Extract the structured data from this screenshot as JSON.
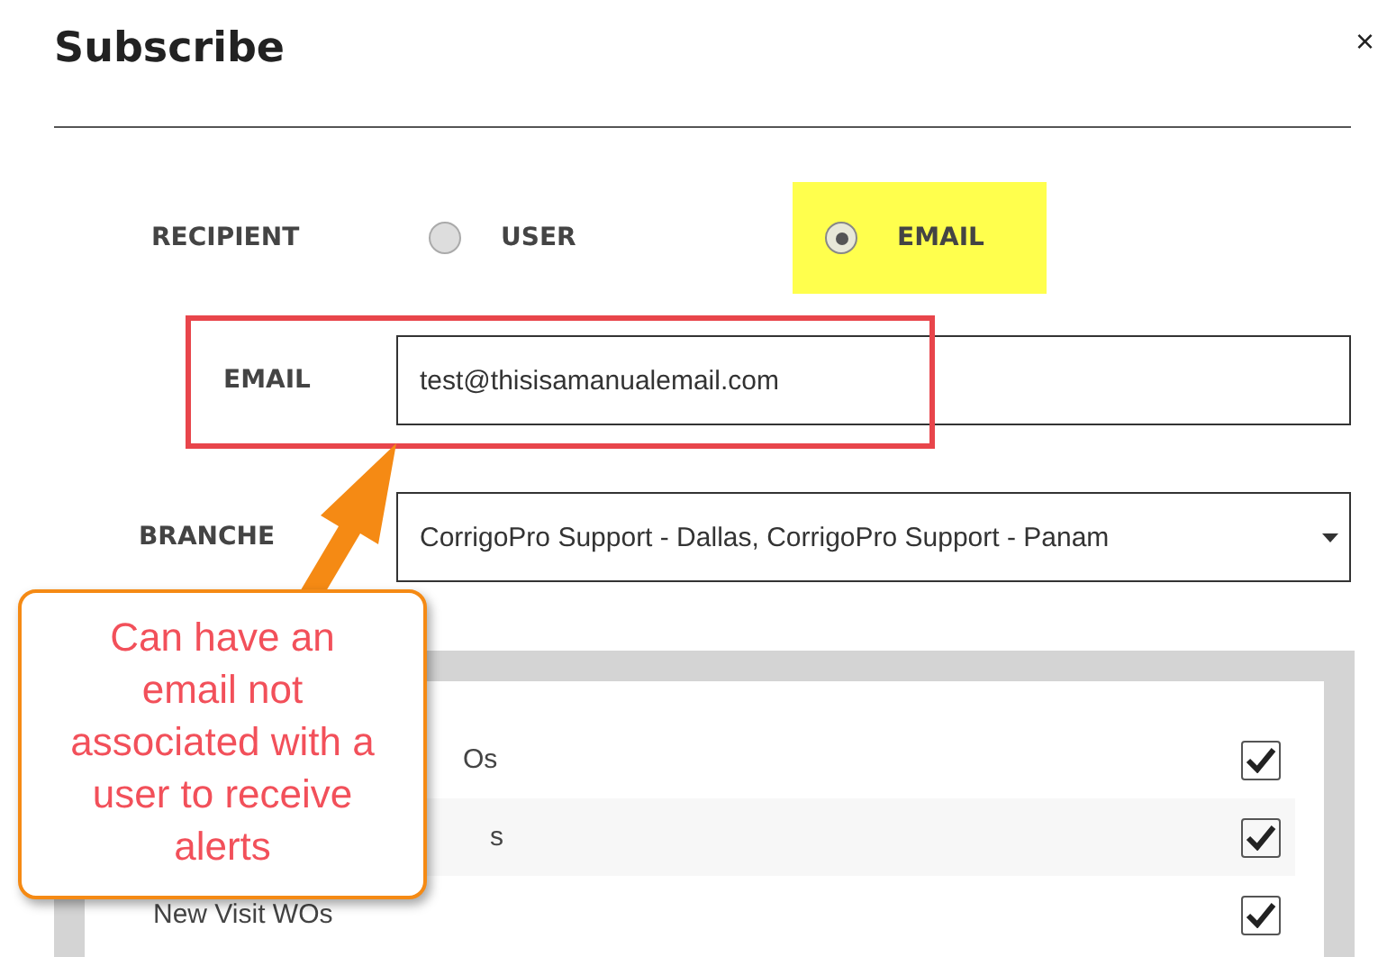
{
  "dialog": {
    "title": "Subscribe",
    "close": "×"
  },
  "recipient": {
    "label": "RECIPIENT",
    "options": [
      {
        "label": "USER",
        "selected": false,
        "highlighted": false
      },
      {
        "label": "EMAIL",
        "selected": true,
        "highlighted": true
      }
    ]
  },
  "email": {
    "label": "EMAIL",
    "value": "test@thisisamanualemail.com"
  },
  "branches": {
    "label": "BRANCHE",
    "value": "CorrigoPro Support - Dallas, CorrigoPro Support - Panam"
  },
  "alerts": [
    {
      "label": "Os",
      "checked": true
    },
    {
      "label": "s",
      "checked": true
    },
    {
      "label": "New Visit WOs",
      "checked": true
    }
  ],
  "callout": {
    "text": "Can have an email not associated with a user to receive alerts"
  }
}
